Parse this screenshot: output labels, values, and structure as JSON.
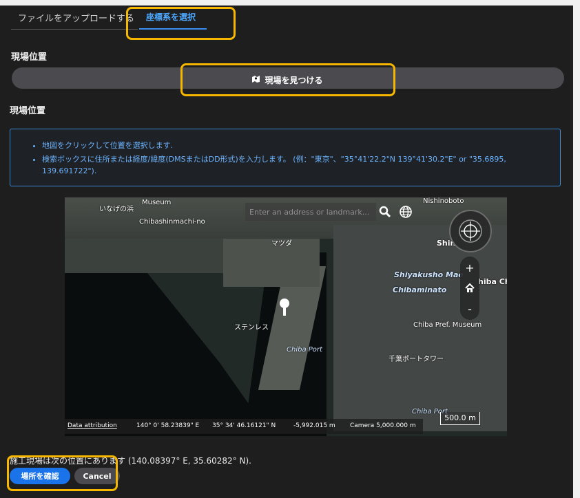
{
  "tabs": {
    "upload": "ファイルをアップロードする",
    "coords": "座標系を選択"
  },
  "site": {
    "heading": "現場位置",
    "find_button": "現場を見つける",
    "heading2": "現場位置"
  },
  "info": {
    "items": [
      "地図をクリックして位置を選択します.",
      "検索ボックスに住所または経度/緯度(DMSまたはDD形式)を入力します。 (例：\"東京\"、\"35°41'22.2\"N 139°41'30.2\"E\" or \"35.6895, 139.691722\")."
    ]
  },
  "map": {
    "search_placeholder": "Enter an address or landmark...",
    "labels": {
      "inage": "いなげの浜",
      "museum": "Museum",
      "chibashi": "Chibashinmachi-no",
      "matsuda": "マツダ",
      "shin": "Shin",
      "shiyakusho": "Shiyakusho Mae",
      "chibach": "hiba Ch",
      "chibaminato": "Chibaminato",
      "chibaport": "Chiba Port",
      "steel": "ステンレス",
      "chibaport2": "Chiba Port",
      "chibapref": "Chiba Pref. Museum",
      "portisland": "千葉ポートタワー",
      "nishinoboto": "Nishinoboto"
    },
    "zoom_in": "+",
    "zoom_out": "-",
    "status": {
      "attribution": "Data attribution",
      "longitude": "140° 0' 58.23839\" E",
      "latitude": "35° 34' 46.16121\" N",
      "elevation": "-5,992.015 m",
      "camera": "Camera 5,000.000 m"
    },
    "scale": "500.0 m"
  },
  "result": {
    "text": "施工現場は次の位置にあります (140.08397° E, 35.60282° N)."
  },
  "actions": {
    "confirm": "場所を確認",
    "cancel": "Cancel"
  },
  "colors": {
    "accent": "#1a73e8",
    "highlight": "#f5b700",
    "info_text": "#6cb4ff"
  }
}
